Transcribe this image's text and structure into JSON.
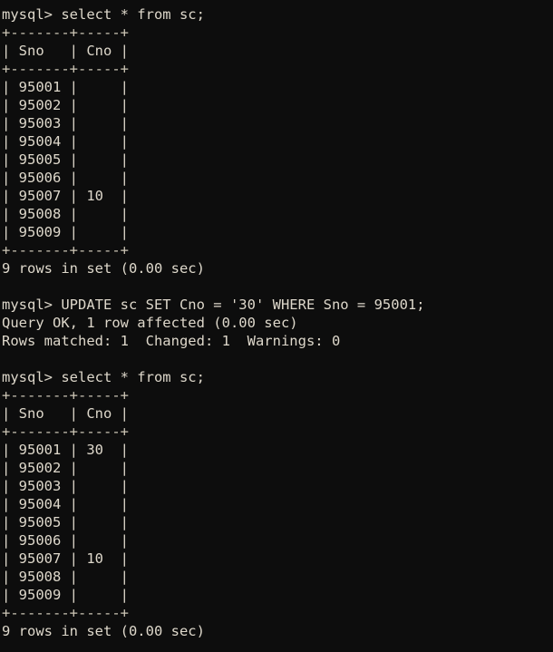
{
  "terminal": {
    "app": "mysql-client",
    "prompt": "mysql>",
    "background_color": "#0d0d0d",
    "foreground_color": "#d9d4c8",
    "columns": 78,
    "rows": 36
  },
  "session": {
    "lines": [
      {
        "kind": "prompt",
        "text": "mysql> select * from sc;"
      },
      {
        "kind": "rule",
        "text": "+-------+-----+"
      },
      {
        "kind": "header",
        "text": "| Sno   | Cno |"
      },
      {
        "kind": "rule",
        "text": "+-------+-----+"
      },
      {
        "kind": "row",
        "text": "| 95001 |     |"
      },
      {
        "kind": "row",
        "text": "| 95002 |     |"
      },
      {
        "kind": "row",
        "text": "| 95003 |     |"
      },
      {
        "kind": "row",
        "text": "| 95004 |     |"
      },
      {
        "kind": "row",
        "text": "| 95005 |     |"
      },
      {
        "kind": "row",
        "text": "| 95006 |     |"
      },
      {
        "kind": "row",
        "text": "| 95007 | 10  |"
      },
      {
        "kind": "row",
        "text": "| 95008 |     |"
      },
      {
        "kind": "row",
        "text": "| 95009 |     |"
      },
      {
        "kind": "rule",
        "text": "+-------+-----+"
      },
      {
        "kind": "status",
        "text": "9 rows in set (0.00 sec)"
      },
      {
        "kind": "blank",
        "text": ""
      },
      {
        "kind": "prompt",
        "text": "mysql> UPDATE sc SET Cno = '30' WHERE Sno = 95001;"
      },
      {
        "kind": "status",
        "text": "Query OK, 1 row affected (0.00 sec)"
      },
      {
        "kind": "status",
        "text": "Rows matched: 1  Changed: 1  Warnings: 0"
      },
      {
        "kind": "blank",
        "text": ""
      },
      {
        "kind": "prompt",
        "text": "mysql> select * from sc;"
      },
      {
        "kind": "rule",
        "text": "+-------+-----+"
      },
      {
        "kind": "header",
        "text": "| Sno   | Cno |"
      },
      {
        "kind": "rule",
        "text": "+-------+-----+"
      },
      {
        "kind": "row",
        "text": "| 95001 | 30  |"
      },
      {
        "kind": "row",
        "text": "| 95002 |     |"
      },
      {
        "kind": "row",
        "text": "| 95003 |     |"
      },
      {
        "kind": "row",
        "text": "| 95004 |     |"
      },
      {
        "kind": "row",
        "text": "| 95005 |     |"
      },
      {
        "kind": "row",
        "text": "| 95006 |     |"
      },
      {
        "kind": "row",
        "text": "| 95007 | 10  |"
      },
      {
        "kind": "row",
        "text": "| 95008 |     |"
      },
      {
        "kind": "row",
        "text": "| 95009 |     |"
      },
      {
        "kind": "rule",
        "text": "+-------+-----+"
      },
      {
        "kind": "status",
        "text": "9 rows in set (0.00 sec)"
      }
    ]
  },
  "queries": [
    {
      "sql": "select * from sc;",
      "result_status": "9 rows in set (0.00 sec)",
      "row_count": 9
    },
    {
      "sql": "UPDATE sc SET Cno = '30' WHERE Sno = 95001;",
      "result_status": "Query OK, 1 row affected (0.00 sec)",
      "detail": "Rows matched: 1  Changed: 1  Warnings: 0"
    },
    {
      "sql": "select * from sc;",
      "result_status": "9 rows in set (0.00 sec)",
      "row_count": 9
    }
  ],
  "tables": [
    {
      "name": "sc",
      "when": "before-update",
      "columns": [
        "Sno",
        "Cno"
      ],
      "rows": [
        {
          "Sno": "95001",
          "Cno": ""
        },
        {
          "Sno": "95002",
          "Cno": ""
        },
        {
          "Sno": "95003",
          "Cno": ""
        },
        {
          "Sno": "95004",
          "Cno": ""
        },
        {
          "Sno": "95005",
          "Cno": ""
        },
        {
          "Sno": "95006",
          "Cno": ""
        },
        {
          "Sno": "95007",
          "Cno": "10"
        },
        {
          "Sno": "95008",
          "Cno": ""
        },
        {
          "Sno": "95009",
          "Cno": ""
        }
      ]
    },
    {
      "name": "sc",
      "when": "after-update",
      "columns": [
        "Sno",
        "Cno"
      ],
      "rows": [
        {
          "Sno": "95001",
          "Cno": "30"
        },
        {
          "Sno": "95002",
          "Cno": ""
        },
        {
          "Sno": "95003",
          "Cno": ""
        },
        {
          "Sno": "95004",
          "Cno": ""
        },
        {
          "Sno": "95005",
          "Cno": ""
        },
        {
          "Sno": "95006",
          "Cno": ""
        },
        {
          "Sno": "95007",
          "Cno": "10"
        },
        {
          "Sno": "95008",
          "Cno": ""
        },
        {
          "Sno": "95009",
          "Cno": ""
        }
      ]
    }
  ]
}
